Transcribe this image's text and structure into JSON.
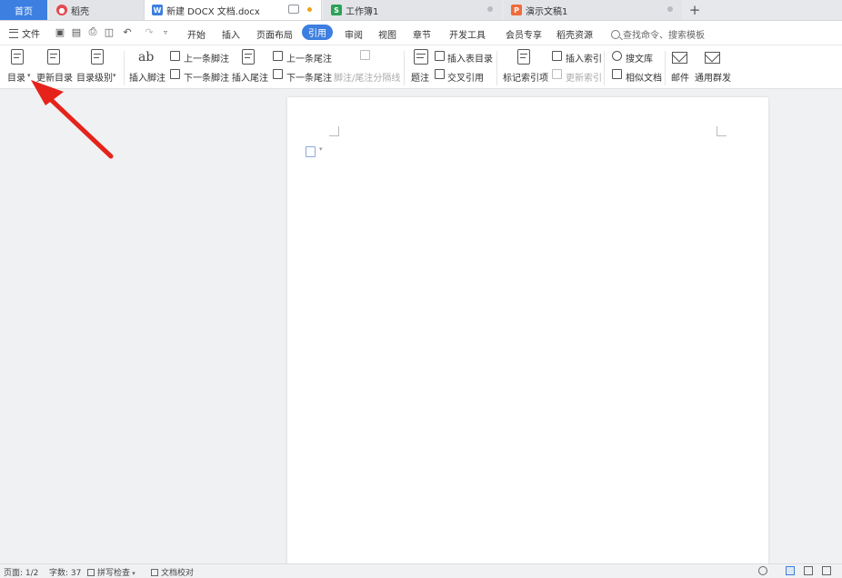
{
  "tabs": {
    "home": "首页",
    "doc": "稻壳",
    "active": "新建 DOCX 文档.docx",
    "sheet": "工作簿1",
    "ppt": "演示文稿1",
    "new": "+"
  },
  "tab_icon_letters": {
    "sheet": "S",
    "ppt": "P",
    "active": "W"
  },
  "colors": {
    "accent": "#3c7fe0",
    "docer": "#e5484d",
    "writer": "#3c7fe0",
    "sheet": "#2aa157",
    "ppt": "#f06a3a",
    "arrow": "#e5231b"
  },
  "menu": {
    "file": "文件",
    "items": [
      "开始",
      "插入",
      "页面布局",
      "引用",
      "审阅",
      "视图",
      "章节",
      "开发工具",
      "会员专享",
      "稻壳资源"
    ],
    "active": "引用",
    "search": "查找命令、搜索模板"
  },
  "ribbon": {
    "toc": "目录",
    "update_toc": "更新目录",
    "toc_level": "目录级别",
    "insert_footnote": "插入脚注",
    "prev_footnote": "上一条脚注",
    "next_footnote": "下一条脚注",
    "insert_endnote": "插入尾注",
    "prev_endnote": "上一条尾注",
    "next_endnote": "下一条尾注",
    "separator": "脚注/尾注分隔线",
    "caption": "题注",
    "insert_table_toc": "插入表目录",
    "cross_ref": "交叉引用",
    "mark_index": "标记索引项",
    "insert_index": "插入索引",
    "update_index": "更新索引",
    "search_lib": "搜文库",
    "similar_doc": "相似文档",
    "mail": "邮件",
    "mass_mail": "通用群发",
    "ab": "ab"
  },
  "status": {
    "page": "页面: 1/2",
    "words": "字数: 37",
    "spell": "拼写检查",
    "proof": "文档校对"
  }
}
